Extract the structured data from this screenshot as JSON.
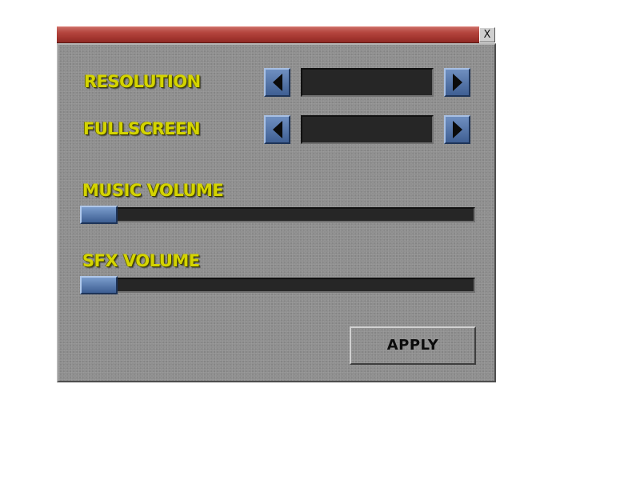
{
  "window": {
    "close_label": "X"
  },
  "settings": {
    "resolution": {
      "label": "RESOLUTION",
      "value": ""
    },
    "fullscreen": {
      "label": "FULLSCREEN",
      "value": ""
    },
    "music_volume": {
      "label": "MUSIC VOLUME",
      "level": 0
    },
    "sfx_volume": {
      "label": "SFX VOLUME",
      "level": 0
    }
  },
  "apply_label": "APPLY",
  "colors": {
    "title_bar": "#b4453e",
    "panel": "#8f8f8f",
    "label_text": "#d4d400",
    "button_blue": "#4f6fa3",
    "field_dark": "#262626"
  },
  "icons": {
    "prev": "left-arrow-icon",
    "next": "right-arrow-icon"
  }
}
